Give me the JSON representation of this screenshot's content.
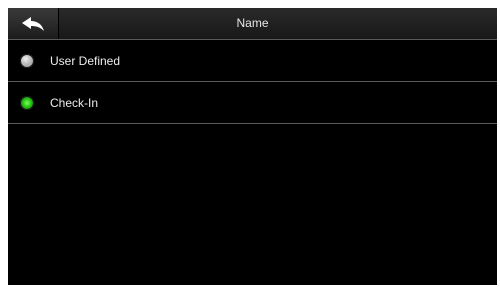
{
  "header": {
    "title": "Name",
    "back_icon": "back-arrow-icon"
  },
  "options": [
    {
      "label": "User Defined",
      "selected": false
    },
    {
      "label": "Check-In",
      "selected": true
    }
  ],
  "colors": {
    "background": "#000000",
    "selected_radio": "#2fd11b",
    "divider": "#5a5a5a"
  }
}
